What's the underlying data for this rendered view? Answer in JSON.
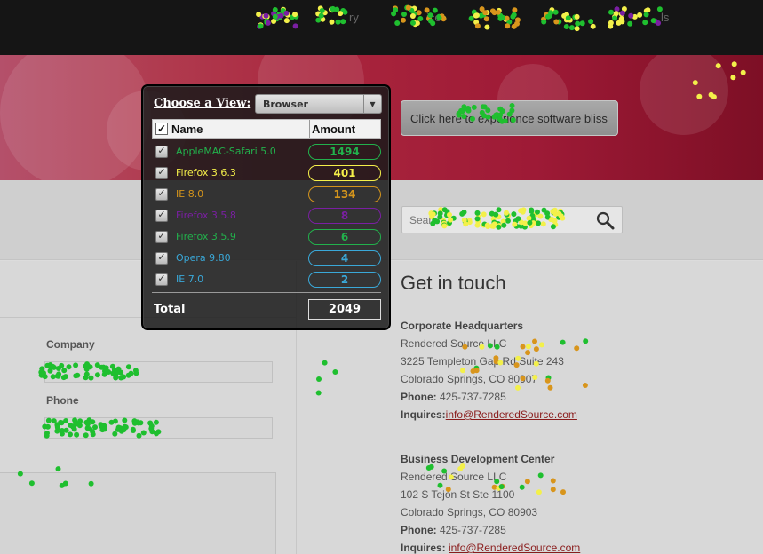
{
  "nav": {
    "items": [
      "ry",
      "ice",
      "ls"
    ]
  },
  "banner": {
    "cta_label": "Click here to experience software bliss"
  },
  "search": {
    "placeholder": "Search"
  },
  "form": {
    "company_label": "Company",
    "phone_label": "Phone"
  },
  "contact": {
    "heading": "Get in touch",
    "hq": {
      "title": "Corporate Headquarters",
      "name": "Rendered Source LLC",
      "street": "3225 Templeton Gap Rd Suite 243",
      "city": "Colorado Springs, CO 80907",
      "phone_label": "Phone:",
      "phone": " 425-737-7285",
      "inquires_label": "Inquires:",
      "email": "info@RenderedSource.com"
    },
    "bdc": {
      "title": "Business Development Center",
      "name": "Rendered Source LLC",
      "street": "102 S Tejon St Ste 1100",
      "city": "Colorado Springs, CO 80903",
      "phone_label": "Phone:",
      "phone": " 425-737-7285",
      "inquires_label": "Inquires:",
      "email": "info@RenderedSource.com"
    }
  },
  "widget": {
    "view_label": "Choose a View:",
    "view_selected": "Browser",
    "col_name": "Name",
    "col_amount": "Amount",
    "rows": [
      {
        "name": "AppleMAC-Safari 5.0",
        "amount": "1494",
        "color": "#22b14c"
      },
      {
        "name": "Firefox 3.6.3",
        "amount": "401",
        "color": "#f5f04a"
      },
      {
        "name": "IE 8.0",
        "amount": "134",
        "color": "#d4941c"
      },
      {
        "name": "Firefox 3.5.8",
        "amount": "8",
        "color": "#7a1fa2"
      },
      {
        "name": "Firefox 3.5.9",
        "amount": "6",
        "color": "#22b14c"
      },
      {
        "name": "Opera 9.80",
        "amount": "4",
        "color": "#3aa8d8"
      },
      {
        "name": "IE 7.0",
        "amount": "2",
        "color": "#3aa8d8"
      }
    ],
    "total_label": "Total",
    "total_value": "2049"
  },
  "colors": {
    "green": "#1fbf2f",
    "yellow": "#f3f04a",
    "orange": "#d8951c",
    "purple": "#7a1fa2"
  },
  "chart_data": {
    "type": "scatter",
    "series": [
      {
        "name": "AppleMAC-Safari 5.0",
        "color": "#1fbf2f",
        "value": 1494
      },
      {
        "name": "Firefox 3.6.3",
        "color": "#f3f04a",
        "value": 401
      },
      {
        "name": "IE 8.0",
        "color": "#d8951c",
        "value": 134
      },
      {
        "name": "Firefox 3.5.8",
        "color": "#7a1fa2",
        "value": 8
      }
    ]
  }
}
